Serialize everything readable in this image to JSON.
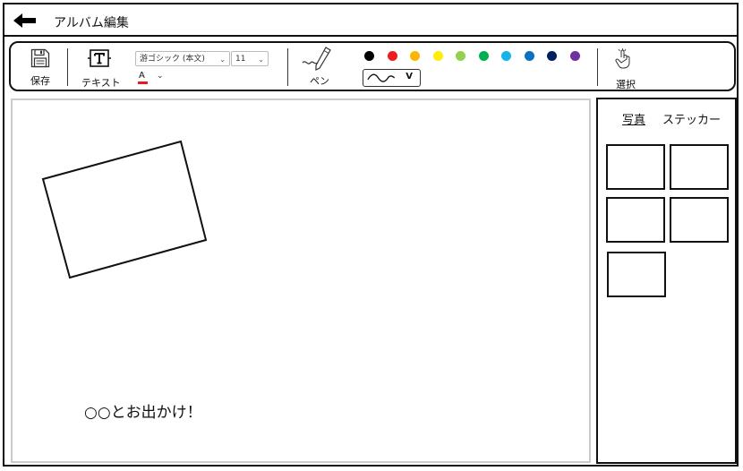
{
  "window": {
    "title": "アルバム編集"
  },
  "toolbar": {
    "save_label": "保存",
    "text_label": "テキスト",
    "font_family": "游ゴシック (本文)",
    "font_size": "11",
    "font_color_letter": "A",
    "pen_label": "ペン",
    "pen_style_value": "V",
    "select_label": "選択",
    "colors": [
      {
        "name": "black",
        "hex": "#000000"
      },
      {
        "name": "red",
        "hex": "#ee1c1c"
      },
      {
        "name": "orange",
        "hex": "#ffb400"
      },
      {
        "name": "yellow",
        "hex": "#ffee00"
      },
      {
        "name": "light-green",
        "hex": "#92d050"
      },
      {
        "name": "green",
        "hex": "#00b050"
      },
      {
        "name": "sky-blue",
        "hex": "#16b4e8"
      },
      {
        "name": "blue",
        "hex": "#0a70c0"
      },
      {
        "name": "navy",
        "hex": "#002060"
      },
      {
        "name": "purple",
        "hex": "#7030a0"
      }
    ],
    "font_color_hex": "#e81c1c"
  },
  "canvas": {
    "caption": "○○とお出かけ！"
  },
  "side_panel": {
    "tabs": [
      {
        "label": "写真",
        "active": true
      },
      {
        "label": "ステッカー",
        "active": false
      }
    ]
  },
  "icons": {
    "back": "arrow-left-icon",
    "save": "floppy-disk-icon",
    "text": "text-box-icon",
    "pen": "pen-icon",
    "select": "hand-pointer-icon"
  }
}
